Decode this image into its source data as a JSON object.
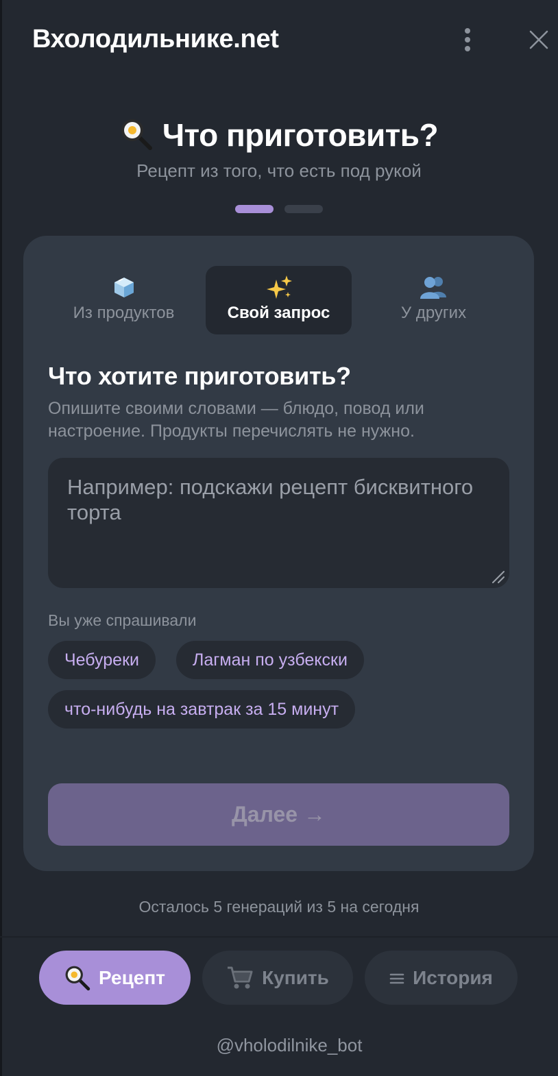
{
  "header": {
    "title": "Вхолодильнике.net",
    "menu_icon": "more-vertical-icon",
    "close_icon": "close-icon"
  },
  "hero": {
    "title": "Что приготовить?",
    "subtitle": "Рецепт из того, что есть под рукой",
    "pager": {
      "total": 2,
      "active": 1
    }
  },
  "tabs": [
    {
      "label": "Из продуктов",
      "icon": "ice-cube-icon",
      "active": false
    },
    {
      "label": "Свой запрос",
      "icon": "sparkles-icon",
      "active": true
    },
    {
      "label": "У других",
      "icon": "people-icon",
      "active": false
    }
  ],
  "form": {
    "title": "Что хотите приготовить?",
    "description": "Опишите своими словами — блюдо, повод или настроение. Продукты перечислять не нужно.",
    "input_placeholder": "Например: подскажи рецепт бисквитного торта",
    "input_value": ""
  },
  "history": {
    "label": "Вы уже спрашивали",
    "chips": [
      "Чебуреки",
      "Лагман по узбекски",
      "что-нибудь на завтрак за 15 минут"
    ]
  },
  "next_button": {
    "label": "Далее →",
    "enabled": false
  },
  "quota": "Осталось 5 генераций из 5 на сегодня",
  "bottom_nav": [
    {
      "label": "Рецепт",
      "icon": "frying-pan-icon",
      "active": true
    },
    {
      "label": "Купить",
      "icon": "shopping-cart-icon",
      "active": false
    },
    {
      "label": "История",
      "icon": "list-icon",
      "active": false
    }
  ],
  "bot_handle": "@vholodilnike_bot",
  "colors": {
    "background": "#232830",
    "card": "#323a45",
    "accent": "#a88fd8",
    "chip_text": "#c7aef0",
    "muted_text": "#8d939c"
  }
}
